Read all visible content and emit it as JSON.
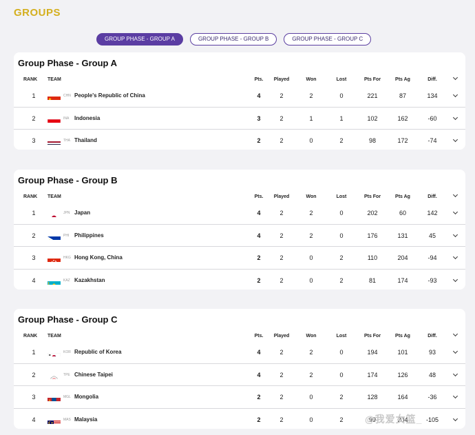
{
  "page": {
    "title": "GROUPS"
  },
  "tabs": [
    {
      "label": "GROUP PHASE - GROUP A",
      "active": true
    },
    {
      "label": "GROUP PHASE - GROUP B",
      "active": false
    },
    {
      "label": "GROUP PHASE - GROUP C",
      "active": false
    }
  ],
  "columns": {
    "rank": "RANK",
    "team": "TEAM",
    "pts": "Pts.",
    "played": "Played",
    "won": "Won",
    "lost": "Lost",
    "pts_for": "Pts For",
    "pts_ag": "Pts Ag",
    "diff": "Diff."
  },
  "groups": [
    {
      "title": "Group Phase - Group A",
      "rows": [
        {
          "rank": "1",
          "code": "CHN",
          "flag": "chn",
          "team": "People's Republic of China",
          "pts": "4",
          "played": "2",
          "won": "2",
          "lost": "0",
          "pf": "221",
          "pa": "87",
          "diff": "134"
        },
        {
          "rank": "2",
          "code": "INA",
          "flag": "ina",
          "team": "Indonesia",
          "pts": "3",
          "played": "2",
          "won": "1",
          "lost": "1",
          "pf": "102",
          "pa": "162",
          "diff": "-60"
        },
        {
          "rank": "3",
          "code": "THA",
          "flag": "tha",
          "team": "Thailand",
          "pts": "2",
          "played": "2",
          "won": "0",
          "lost": "2",
          "pf": "98",
          "pa": "172",
          "diff": "-74"
        }
      ]
    },
    {
      "title": "Group Phase - Group B",
      "rows": [
        {
          "rank": "1",
          "code": "JPN",
          "flag": "jpn",
          "team": "Japan",
          "pts": "4",
          "played": "2",
          "won": "2",
          "lost": "0",
          "pf": "202",
          "pa": "60",
          "diff": "142"
        },
        {
          "rank": "2",
          "code": "PHI",
          "flag": "phi",
          "team": "Philippines",
          "pts": "4",
          "played": "2",
          "won": "2",
          "lost": "0",
          "pf": "176",
          "pa": "131",
          "diff": "45"
        },
        {
          "rank": "3",
          "code": "HKG",
          "flag": "hkg",
          "team": "Hong Kong, China",
          "pts": "2",
          "played": "2",
          "won": "0",
          "lost": "2",
          "pf": "110",
          "pa": "204",
          "diff": "-94"
        },
        {
          "rank": "4",
          "code": "KAZ",
          "flag": "kaz",
          "team": "Kazakhstan",
          "pts": "2",
          "played": "2",
          "won": "0",
          "lost": "2",
          "pf": "81",
          "pa": "174",
          "diff": "-93"
        }
      ]
    },
    {
      "title": "Group Phase - Group C",
      "rows": [
        {
          "rank": "1",
          "code": "KOR",
          "flag": "kor",
          "team": "Republic of Korea",
          "pts": "4",
          "played": "2",
          "won": "2",
          "lost": "0",
          "pf": "194",
          "pa": "101",
          "diff": "93"
        },
        {
          "rank": "2",
          "code": "TPE",
          "flag": "tpe",
          "team": "Chinese Taipei",
          "pts": "4",
          "played": "2",
          "won": "2",
          "lost": "0",
          "pf": "174",
          "pa": "126",
          "diff": "48"
        },
        {
          "rank": "3",
          "code": "MGL",
          "flag": "mgl",
          "team": "Mongolia",
          "pts": "2",
          "played": "2",
          "won": "0",
          "lost": "2",
          "pf": "128",
          "pa": "164",
          "diff": "-36"
        },
        {
          "rank": "4",
          "code": "MAS",
          "flag": "mas",
          "team": "Malaysia",
          "pts": "2",
          "played": "2",
          "won": "0",
          "lost": "2",
          "pf": "99",
          "pa": "204",
          "diff": "-105"
        }
      ]
    }
  ],
  "watermark": "@我爱女篮_"
}
